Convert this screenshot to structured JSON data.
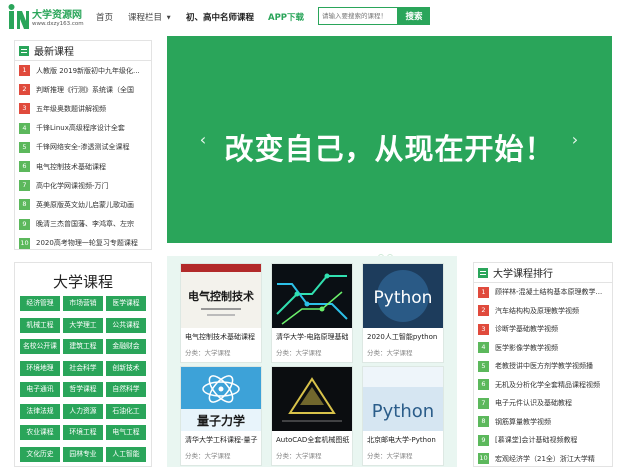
{
  "header": {
    "logo_text": "大学资源网",
    "logo_sub": "www.dxzy163.com",
    "nav": [
      "首页",
      "课程栏目",
      "初、高中名师课程",
      "APP下载"
    ],
    "nav_dropdown_arrow": "▼",
    "search_placeholder": "请输入要搜索的课程！",
    "search_button": "搜索"
  },
  "latest": {
    "title": "最新课程",
    "items": [
      {
        "num": "1",
        "text": "人教版 2019新版初中九年级化..."
      },
      {
        "num": "2",
        "text": "判断推理《行测》系统课（全国"
      },
      {
        "num": "3",
        "text": "五年级奥数题讲解视频"
      },
      {
        "num": "4",
        "text": "千锋Linux高级程序设计全套"
      },
      {
        "num": "5",
        "text": "千锋网络安全-渗透测试全课程"
      },
      {
        "num": "6",
        "text": "电气控制技术基础课程"
      },
      {
        "num": "7",
        "text": "高中化学网课视频-万门"
      },
      {
        "num": "8",
        "text": "英美原版英文幼儿启蒙儿歌动画"
      },
      {
        "num": "9",
        "text": "晚清三杰曾国藩、李鸿章、左宗"
      },
      {
        "num": "10",
        "text": "2020高考物理一轮复习专题课程"
      }
    ]
  },
  "banner": {
    "text": "改变自己，从现在开始！",
    "prev": "‹",
    "next": "›",
    "slides": 3,
    "active_slide": 3
  },
  "categories": {
    "title": "大学课程",
    "items": [
      "经济管理",
      "市场营销",
      "医学课程",
      "机械工程",
      "大学理工",
      "公共课程",
      "名校公开课",
      "建筑工程",
      "金融财会",
      "环境地理",
      "社会科学",
      "创新技术",
      "电子通讯",
      "哲学课程",
      "自然科学",
      "法律法规",
      "人力资源",
      "石油化工",
      "农业课程",
      "环境工程",
      "电气工程",
      "文化历史",
      "园林专业",
      "人工智能"
    ]
  },
  "courses": [
    {
      "title": "电气控制技术基础课程",
      "category": "分类：大学课程",
      "cover_text": "电气控制技术"
    },
    {
      "title": "清华大学-电路原理基础",
      "category": "分类：大学课程",
      "cover_text": ""
    },
    {
      "title": "2020人工智能python",
      "category": "分类：大学课程",
      "cover_text": "Python"
    },
    {
      "title": "清华大学工科课程-量子",
      "category": "分类：大学课程",
      "cover_text": "量子力学"
    },
    {
      "title": "AutoCAD全套机械图纸",
      "category": "分类：大学课程",
      "cover_text": ""
    },
    {
      "title": "北京邮电大学-Python",
      "category": "分类：大学课程",
      "cover_text": "Python"
    }
  ],
  "ranking": {
    "title": "大学课程排行",
    "items": [
      {
        "num": "1",
        "text": "顾祥林-混凝土结构基本原理教学..."
      },
      {
        "num": "2",
        "text": "汽车结构构及原理教学视频"
      },
      {
        "num": "3",
        "text": "诊断学基础教学视频"
      },
      {
        "num": "4",
        "text": "医学影像学教学视频"
      },
      {
        "num": "5",
        "text": "老教授讲中医方剂学教学视频播"
      },
      {
        "num": "6",
        "text": "无机及分析化学全套精品课程视频"
      },
      {
        "num": "7",
        "text": "电子元件认识及基础教程"
      },
      {
        "num": "8",
        "text": "钢筋算量教学视频"
      },
      {
        "num": "9",
        "text": "[慕课堂]会计基础视频教程"
      },
      {
        "num": "10",
        "text": "宏观经济学（21全）浙江大学精"
      }
    ]
  },
  "colors": {
    "brand_green": "#2aa55a",
    "rank_red": "#e04a3c",
    "rank_green": "#5cb85c",
    "grid_bg": "#e9f6f1"
  }
}
